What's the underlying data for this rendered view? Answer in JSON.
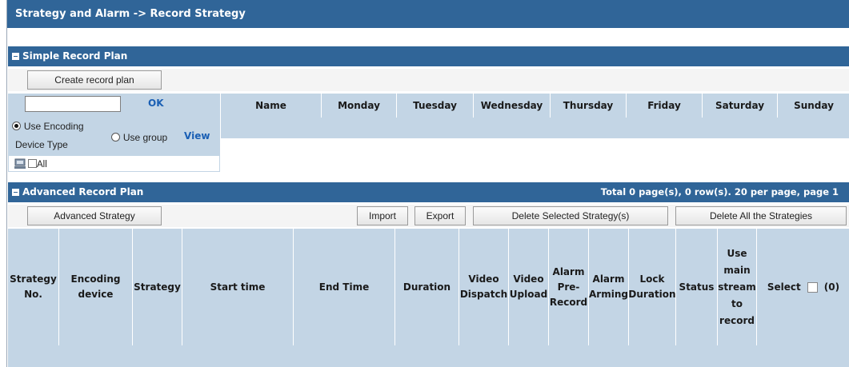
{
  "title": "Strategy and Alarm -> Record Strategy",
  "simple": {
    "section_title": "Simple Record Plan",
    "create_button": "Create record plan",
    "search_value": "",
    "ok_label": "OK",
    "columns": [
      "Name",
      "Monday",
      "Tuesday",
      "Wednesday",
      "Thursday",
      "Friday",
      "Saturday",
      "Sunday"
    ],
    "use_encoding_label": "Use Encoding",
    "device_type_label": "Device Type",
    "use_group_label": "Use group",
    "view_label": "View",
    "all_label": "All"
  },
  "advanced": {
    "section_title": "Advanced Record Plan",
    "paging": "Total 0 page(s), 0 row(s). 20 per page, page 1",
    "buttons": {
      "advanced_strategy": "Advanced Strategy",
      "import": "Import",
      "export": "Export",
      "delete_selected": "Delete Selected Strategy(s)",
      "delete_all": "Delete All the Strategies"
    },
    "columns": {
      "strategy_no": [
        "Strategy",
        "No."
      ],
      "encoding_device": [
        "Encoding",
        "device"
      ],
      "strategy": [
        "Strategy"
      ],
      "start_time": [
        "Start time"
      ],
      "end_time": [
        "End Time"
      ],
      "duration": [
        "Duration"
      ],
      "video_dispatch": [
        "Video",
        "Dispatch"
      ],
      "video_upload": [
        "Video",
        "Upload"
      ],
      "alarm_pre_record": [
        "Alarm",
        "Pre-",
        "Record"
      ],
      "alarm_arming": [
        "Alarm",
        "Arming"
      ],
      "lock_duration": [
        "Lock",
        "Duration"
      ],
      "status": [
        "Status"
      ],
      "use_main_stream": [
        "Use",
        "main",
        "stream",
        "to",
        "record"
      ],
      "select_label": "Select",
      "select_count": "(0)"
    },
    "rows": []
  },
  "colors": {
    "title_bar": "#306598",
    "header_row": "#c3d5e5",
    "link": "#1a5fb4"
  }
}
